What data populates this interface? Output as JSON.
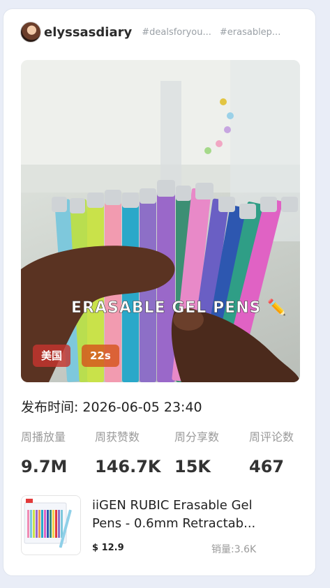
{
  "author": {
    "username": "elyssasdiary",
    "tags": [
      "#dealsforyou...",
      "#erasablep..."
    ]
  },
  "video": {
    "overlay_caption": "ERASABLE GEL PENS ✏️",
    "country_badge": "美国",
    "duration_badge": "22s"
  },
  "publish": {
    "label": "发布时间:",
    "value": "2026-06-05 23:40"
  },
  "stats": [
    {
      "label": "周播放量",
      "value": "9.7M"
    },
    {
      "label": "周获赞数",
      "value": "146.7K"
    },
    {
      "label": "周分享数",
      "value": "15K"
    },
    {
      "label": "周评论数",
      "value": "467"
    }
  ],
  "product": {
    "title": "iiGEN RUBIC Erasable Gel Pens - 0.6mm Retractab...",
    "price": "$ 12.9",
    "sales": "销量:3.6K"
  },
  "colors": {
    "badge_country": "#c4342e",
    "badge_duration": "#d6561c",
    "muted_text": "#9a9a9a"
  }
}
